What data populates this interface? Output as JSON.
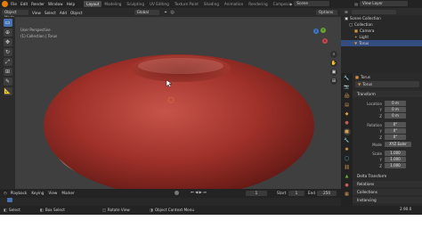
{
  "topbar": {
    "menus": [
      "File",
      "Edit",
      "Render",
      "Window",
      "Help"
    ],
    "workspaces": [
      "Layout",
      "Modeling",
      "Sculpting",
      "UV Editing",
      "Texture Paint",
      "Shading",
      "Animation",
      "Rendering",
      "Composi"
    ],
    "active_workspace": "Layout",
    "scene_label": "Scene",
    "view_layer_label": "View Layer"
  },
  "viewport_header": {
    "mode": "Object Mode",
    "menus": [
      "View",
      "Select",
      "Add",
      "Object"
    ],
    "transform_orientation": "Global",
    "options_label": "Options"
  },
  "viewport": {
    "view_name": "User Perspective",
    "collection_info": "(1) Collection | Torus",
    "gizmo_axes": [
      "X",
      "Y",
      "Z"
    ]
  },
  "outliner": {
    "root": "Scene Collection",
    "items": [
      {
        "label": "Collection"
      },
      {
        "label": "Camera"
      },
      {
        "label": "Light"
      },
      {
        "label": "Torus"
      }
    ]
  },
  "properties": {
    "object_name": "Torus",
    "data_name": "Torus",
    "transform_label": "Transform",
    "location_label": "Location",
    "location": [
      "0 m",
      "0 m",
      "0 m"
    ],
    "rotation_label": "Rotation",
    "rotation": [
      "0°",
      "0°",
      "0°"
    ],
    "mode_label": "Mode",
    "mode_value": "XYZ Euler",
    "scale_label": "Scale",
    "scale": [
      "1.000",
      "1.000",
      "1.000"
    ],
    "axis_labels": [
      "X",
      "Y",
      "Z"
    ],
    "panels": [
      "Delta Transform",
      "Relations",
      "Collections",
      "Instancing"
    ]
  },
  "timeline": {
    "menus": [
      "Playback",
      "Keying",
      "View",
      "Marker"
    ],
    "current_frame": "1",
    "start_label": "Start",
    "start_value": "1",
    "end_label": "End",
    "end_value": "250"
  },
  "statusbar": {
    "select": "Select",
    "box_select": "Box Select",
    "rotate_view": "Rotate View",
    "context_menu": "Object Context Menu",
    "version": "2.90.0"
  },
  "colors": {
    "accent_blue": "#4772b3",
    "torus_red": "#a83a32",
    "viewport_bg": "#3f3f3f"
  }
}
